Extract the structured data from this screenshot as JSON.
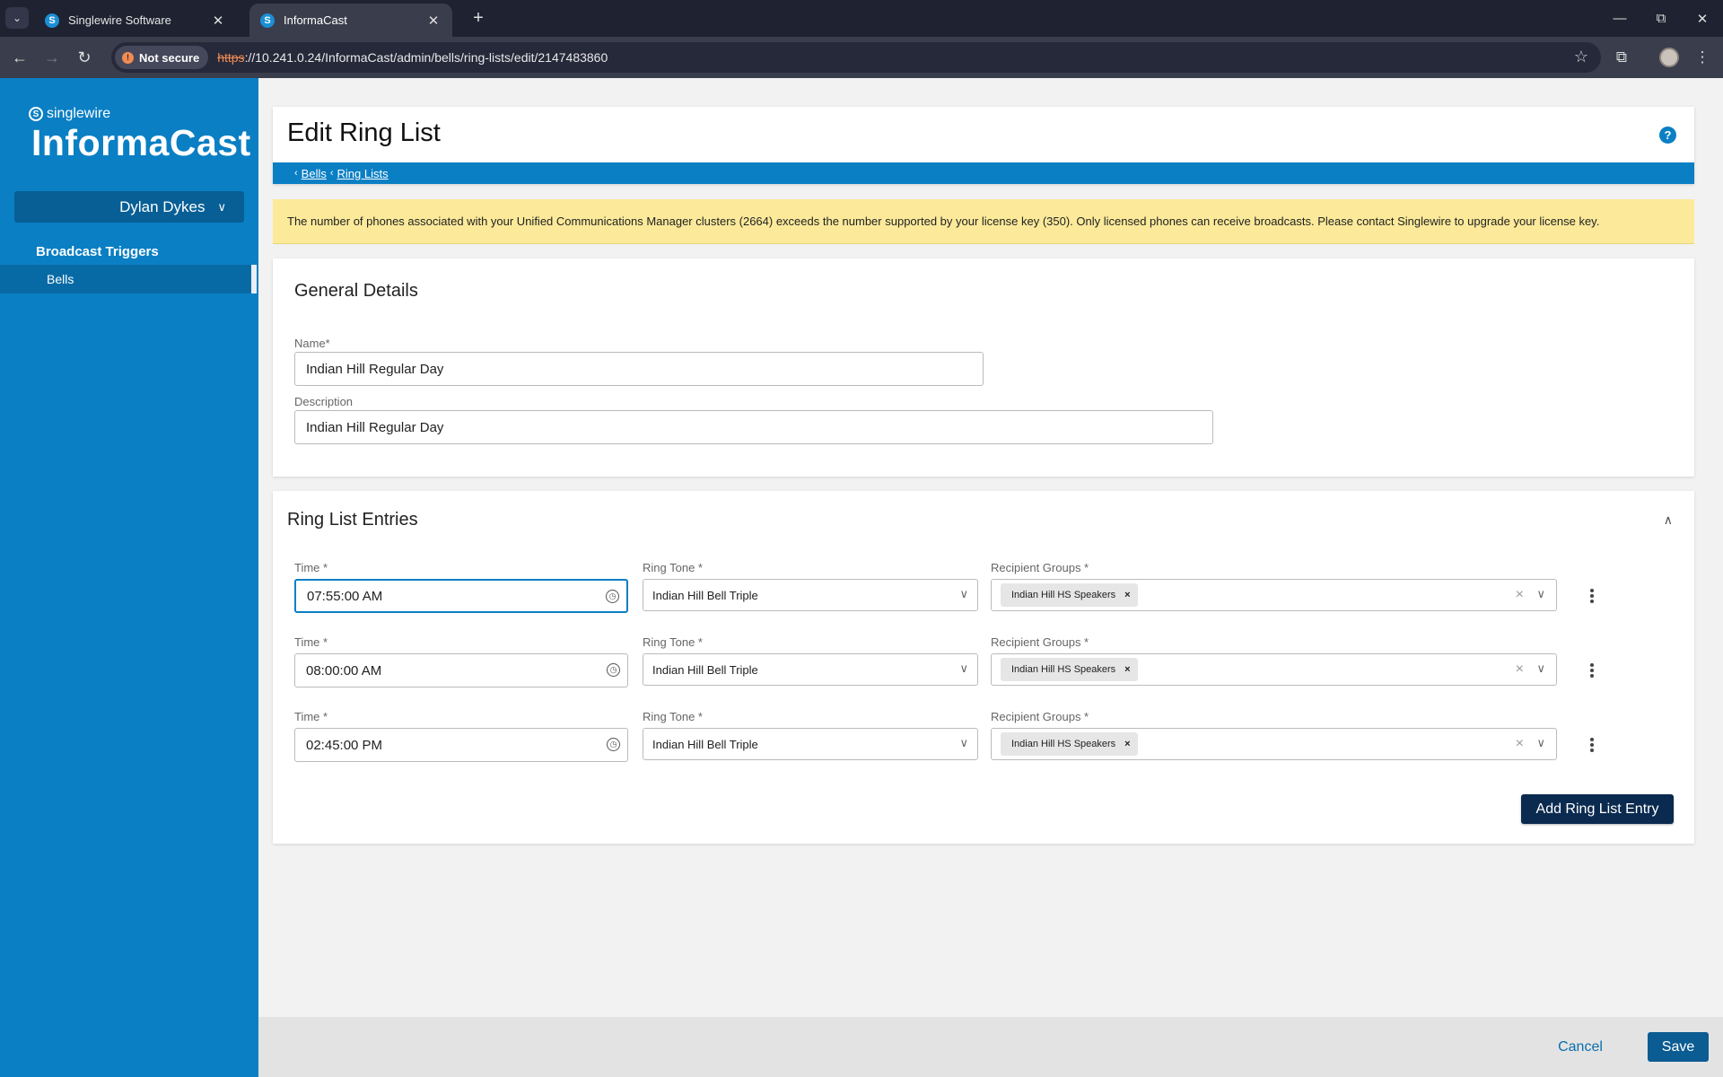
{
  "browser": {
    "tabs": [
      {
        "title": "Singlewire Software",
        "favicon": "singlewire-s-icon",
        "active": false
      },
      {
        "title": "InformaCast",
        "favicon": "singlewire-s-icon",
        "active": true
      }
    ],
    "security_label": "Not secure",
    "url_scheme": "https",
    "url_rest": "://10.241.0.24/InformaCast/admin/bells/ring-lists/edit/2147483860"
  },
  "sidebar": {
    "brand_small": "singlewire",
    "brand_big": "InformaCast",
    "user_name": "Dylan Dykes",
    "section_heading": "Broadcast Triggers",
    "items": [
      {
        "label": "Bells",
        "selected": true
      }
    ]
  },
  "header": {
    "title": "Edit Ring List",
    "breadcrumbs": [
      "Bells",
      "Ring Lists"
    ]
  },
  "license_warning": "The number of phones associated with your Unified Communications Manager clusters (2664) exceeds the number supported by your license key (350). Only licensed phones can receive broadcasts. Please contact Singlewire to upgrade your license key.",
  "general_details": {
    "title": "General Details",
    "name_label": "Name*",
    "name_value": "Indian Hill Regular Day",
    "description_label": "Description",
    "description_value": "Indian Hill Regular Day"
  },
  "ring_list_entries": {
    "title": "Ring List Entries",
    "time_label": "Time *",
    "ring_tone_label": "Ring Tone *",
    "recipient_groups_label": "Recipient Groups *",
    "entries": [
      {
        "time": "07:55:00 AM",
        "ring_tone": "Indian Hill Bell Triple",
        "recipient_groups": [
          "Indian Hill HS Speakers"
        ],
        "focused": true
      },
      {
        "time": "08:00:00 AM",
        "ring_tone": "Indian Hill Bell Triple",
        "recipient_groups": [
          "Indian Hill HS Speakers"
        ],
        "focused": false
      },
      {
        "time": "02:45:00 PM",
        "ring_tone": "Indian Hill Bell Triple",
        "recipient_groups": [
          "Indian Hill HS Speakers"
        ],
        "focused": false
      }
    ],
    "add_button": "Add Ring List Entry"
  },
  "footer": {
    "cancel": "Cancel",
    "save": "Save"
  },
  "colors": {
    "brand_blue": "#0a7fc4",
    "dark_navy": "#0b2a4f",
    "warning_yellow": "#fcea9a",
    "save_blue": "#0b5c92"
  }
}
